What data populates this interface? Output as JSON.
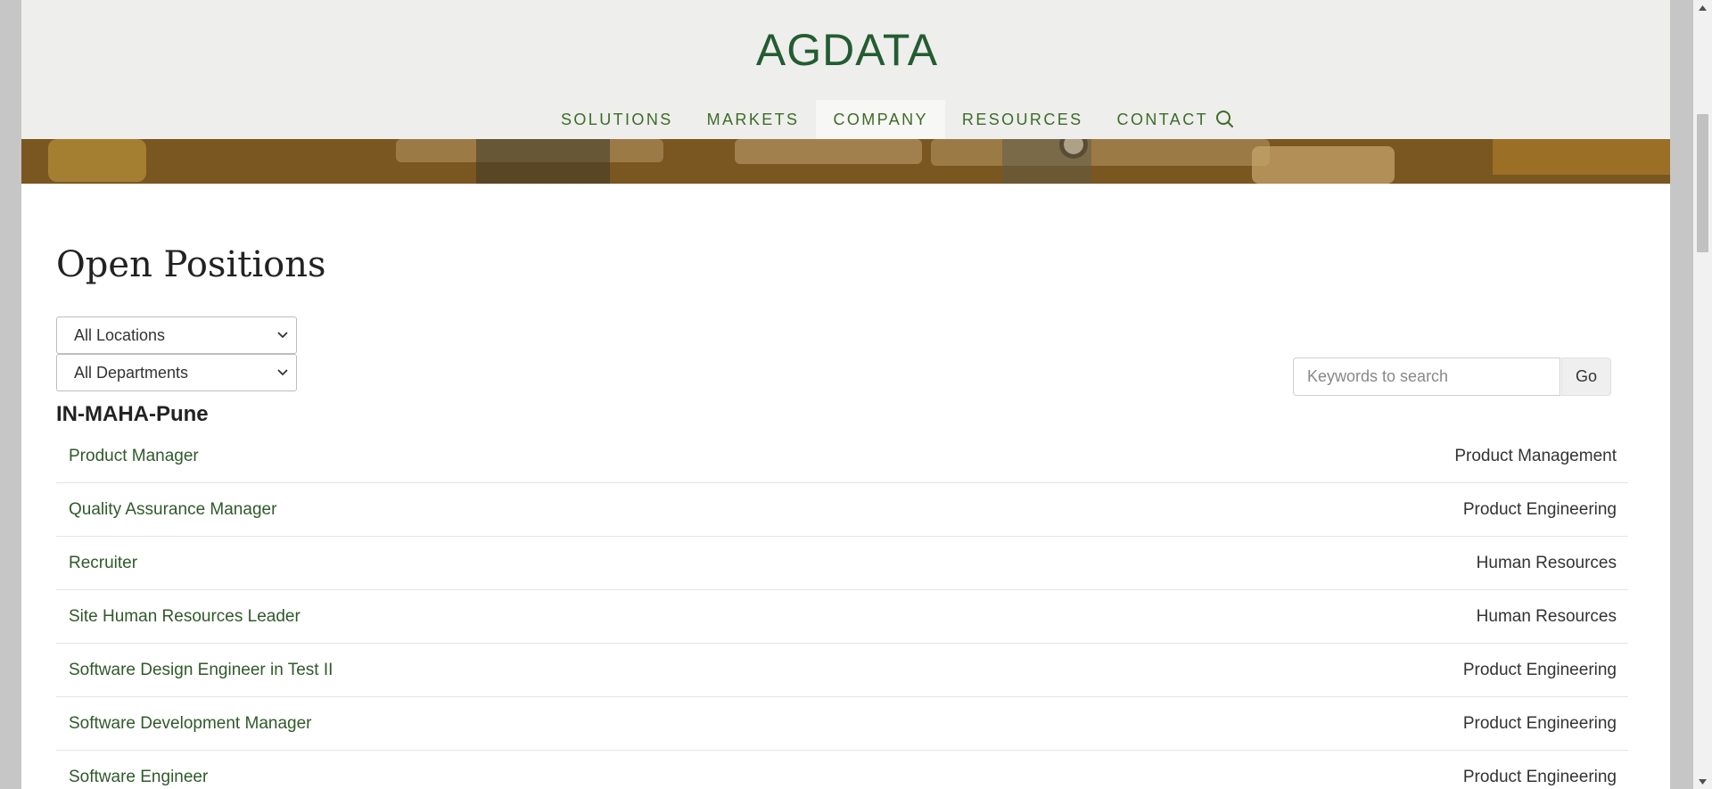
{
  "header": {
    "logo": "AGDATA",
    "nav": [
      {
        "label": "SOLUTIONS",
        "active": false
      },
      {
        "label": "MARKETS",
        "active": false
      },
      {
        "label": "COMPANY",
        "active": true
      },
      {
        "label": "RESOURCES",
        "active": false
      },
      {
        "label": "CONTACT",
        "active": false
      }
    ],
    "search_icon": "search-icon"
  },
  "main": {
    "title": "Open Positions",
    "filters": {
      "location": "All Locations",
      "department": "All Departments"
    },
    "search": {
      "placeholder": "Keywords to search",
      "button": "Go"
    },
    "group": "IN-MAHA-Pune",
    "jobs": [
      {
        "title": "Product Manager",
        "department": "Product Management"
      },
      {
        "title": "Quality Assurance Manager",
        "department": "Product Engineering"
      },
      {
        "title": "Recruiter",
        "department": "Human Resources"
      },
      {
        "title": "Site Human Resources Leader",
        "department": "Human Resources"
      },
      {
        "title": "Software Design Engineer in Test II",
        "department": "Product Engineering"
      },
      {
        "title": "Software Development Manager",
        "department": "Product Engineering"
      },
      {
        "title": "Software Engineer",
        "department": "Product Engineering"
      }
    ]
  },
  "colors": {
    "brand": "#245c32",
    "nav_text": "#3d6c28",
    "link": "#2f5a2a",
    "header_bg": "#eeeeec"
  }
}
